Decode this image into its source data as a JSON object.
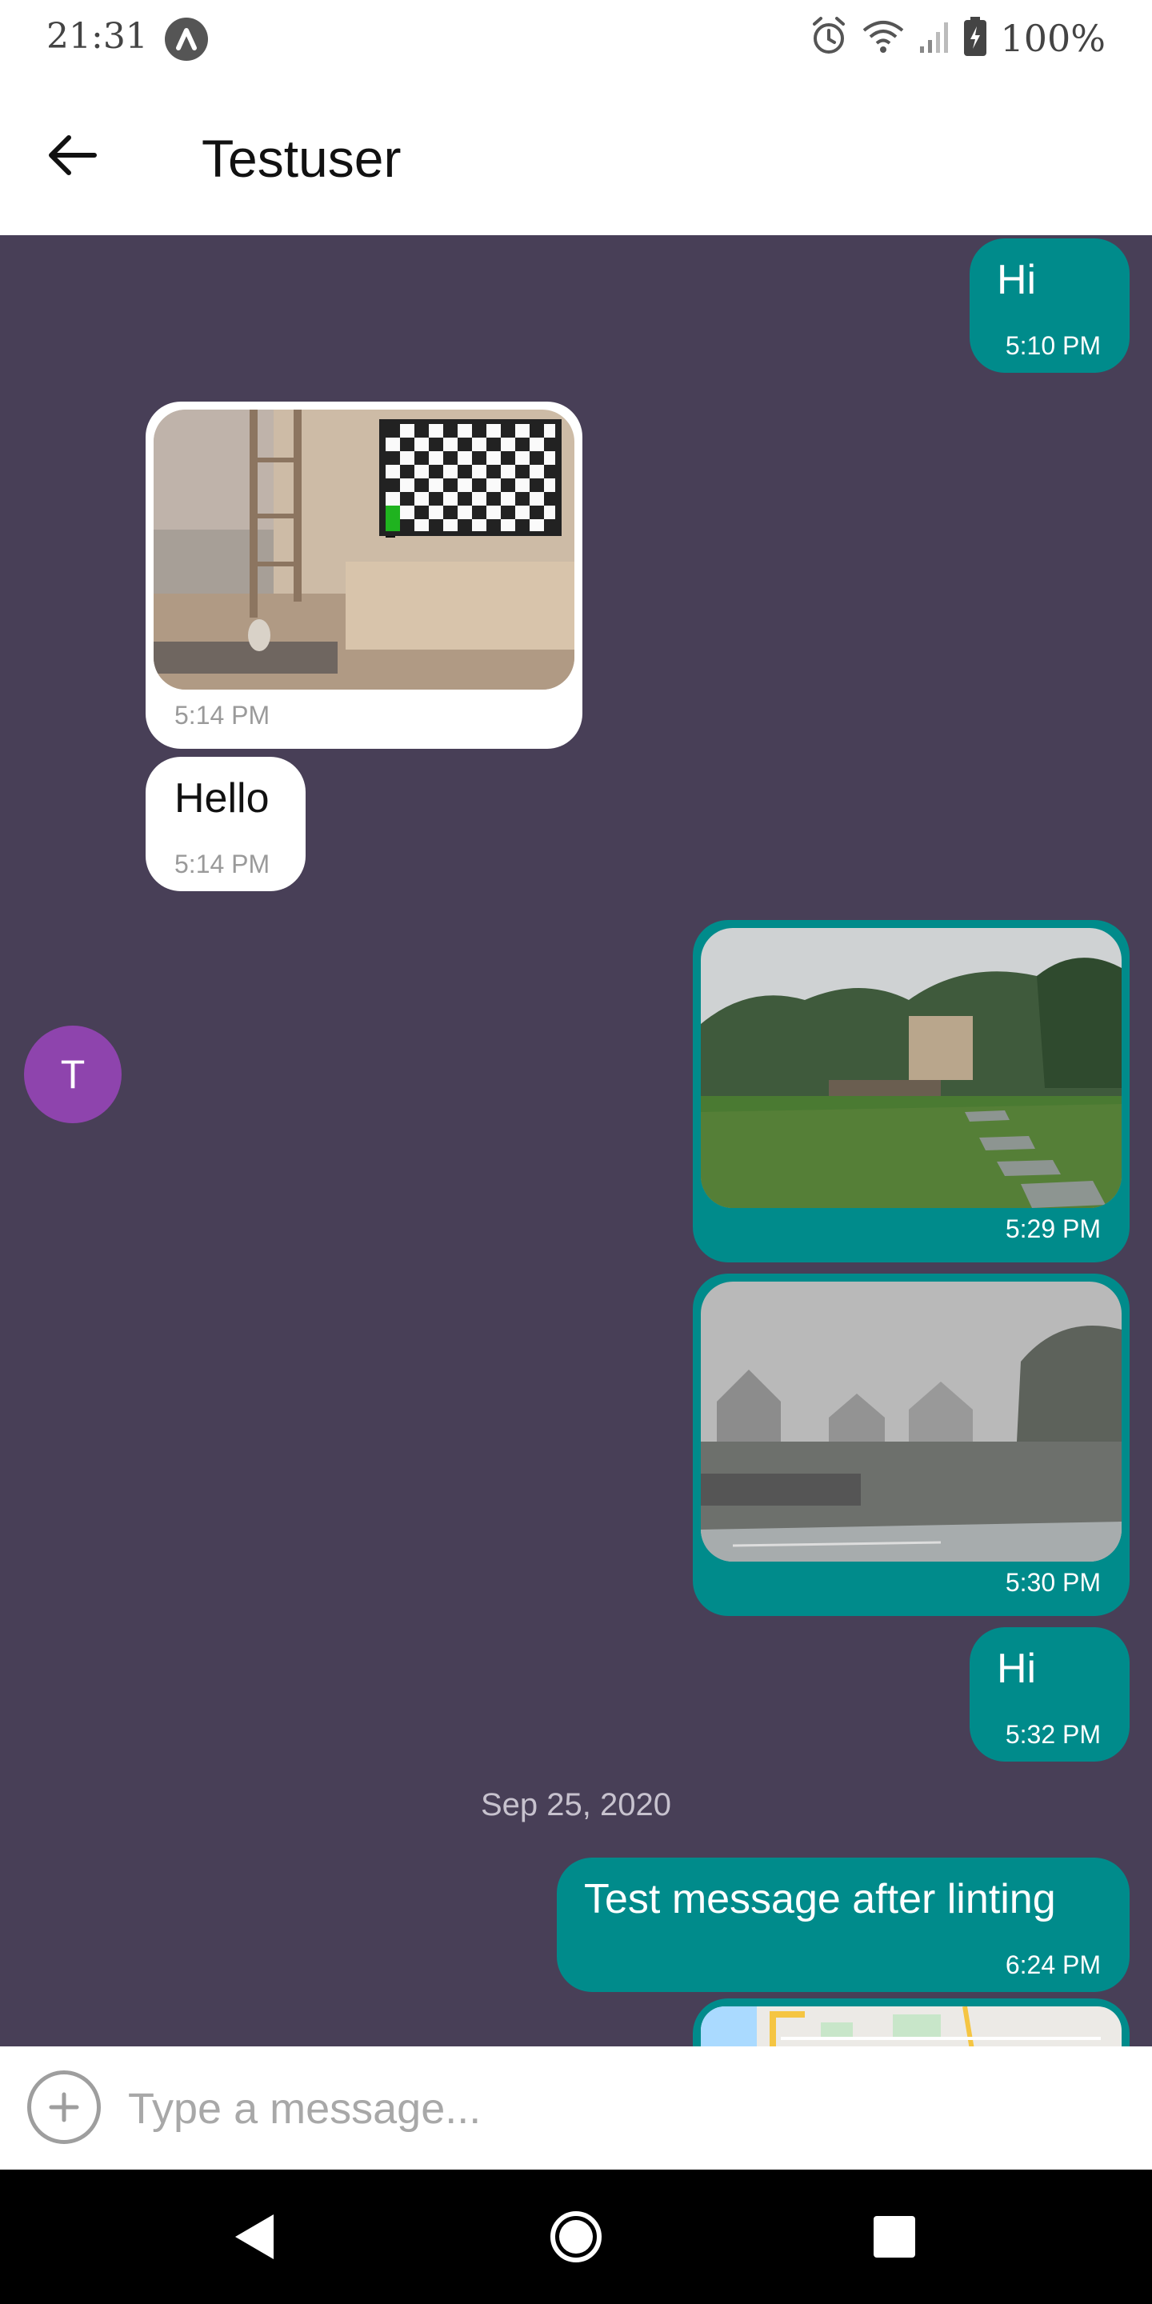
{
  "status_bar": {
    "time": "21:31",
    "battery": "100%",
    "icons": [
      "app-notification-icon",
      "alarm-icon",
      "wifi-icon",
      "signal-icon",
      "battery-charging-icon"
    ]
  },
  "header": {
    "title": "Testuser",
    "back_icon": "arrow-left-icon"
  },
  "contact": {
    "avatar_initial": "T",
    "avatar_color": "#8e44ad"
  },
  "colors": {
    "chat_background": "#483f57",
    "outgoing_bubble": "#008b8b",
    "incoming_bubble": "#ffffff"
  },
  "messages": [
    {
      "direction": "outgoing",
      "type": "text",
      "text": "Hi",
      "time": "5:10 PM"
    },
    {
      "direction": "incoming",
      "type": "image",
      "image": "living-room-tv-photo",
      "time": "5:14 PM"
    },
    {
      "direction": "incoming",
      "type": "text",
      "text": "Hello",
      "time": "5:14 PM"
    },
    {
      "direction": "outgoing",
      "type": "image",
      "image": "garden-lawn-photo",
      "time": "5:29 PM"
    },
    {
      "direction": "outgoing",
      "type": "image",
      "image": "foggy-houses-photo",
      "time": "5:30 PM"
    },
    {
      "direction": "outgoing",
      "type": "text",
      "text": "Hi",
      "time": "5:32 PM"
    },
    {
      "direction": "outgoing",
      "type": "text",
      "text": "Test message after linting",
      "time": "6:24 PM"
    },
    {
      "direction": "outgoing",
      "type": "image",
      "image": "map-location-preview"
    }
  ],
  "date_divider": "Sep 25, 2020",
  "composer": {
    "placeholder": "Type a message...",
    "attach_icon": "plus-circle-icon"
  },
  "nav_bar": {
    "icons": [
      "back-triangle-icon",
      "home-circle-icon",
      "recents-square-icon"
    ]
  }
}
